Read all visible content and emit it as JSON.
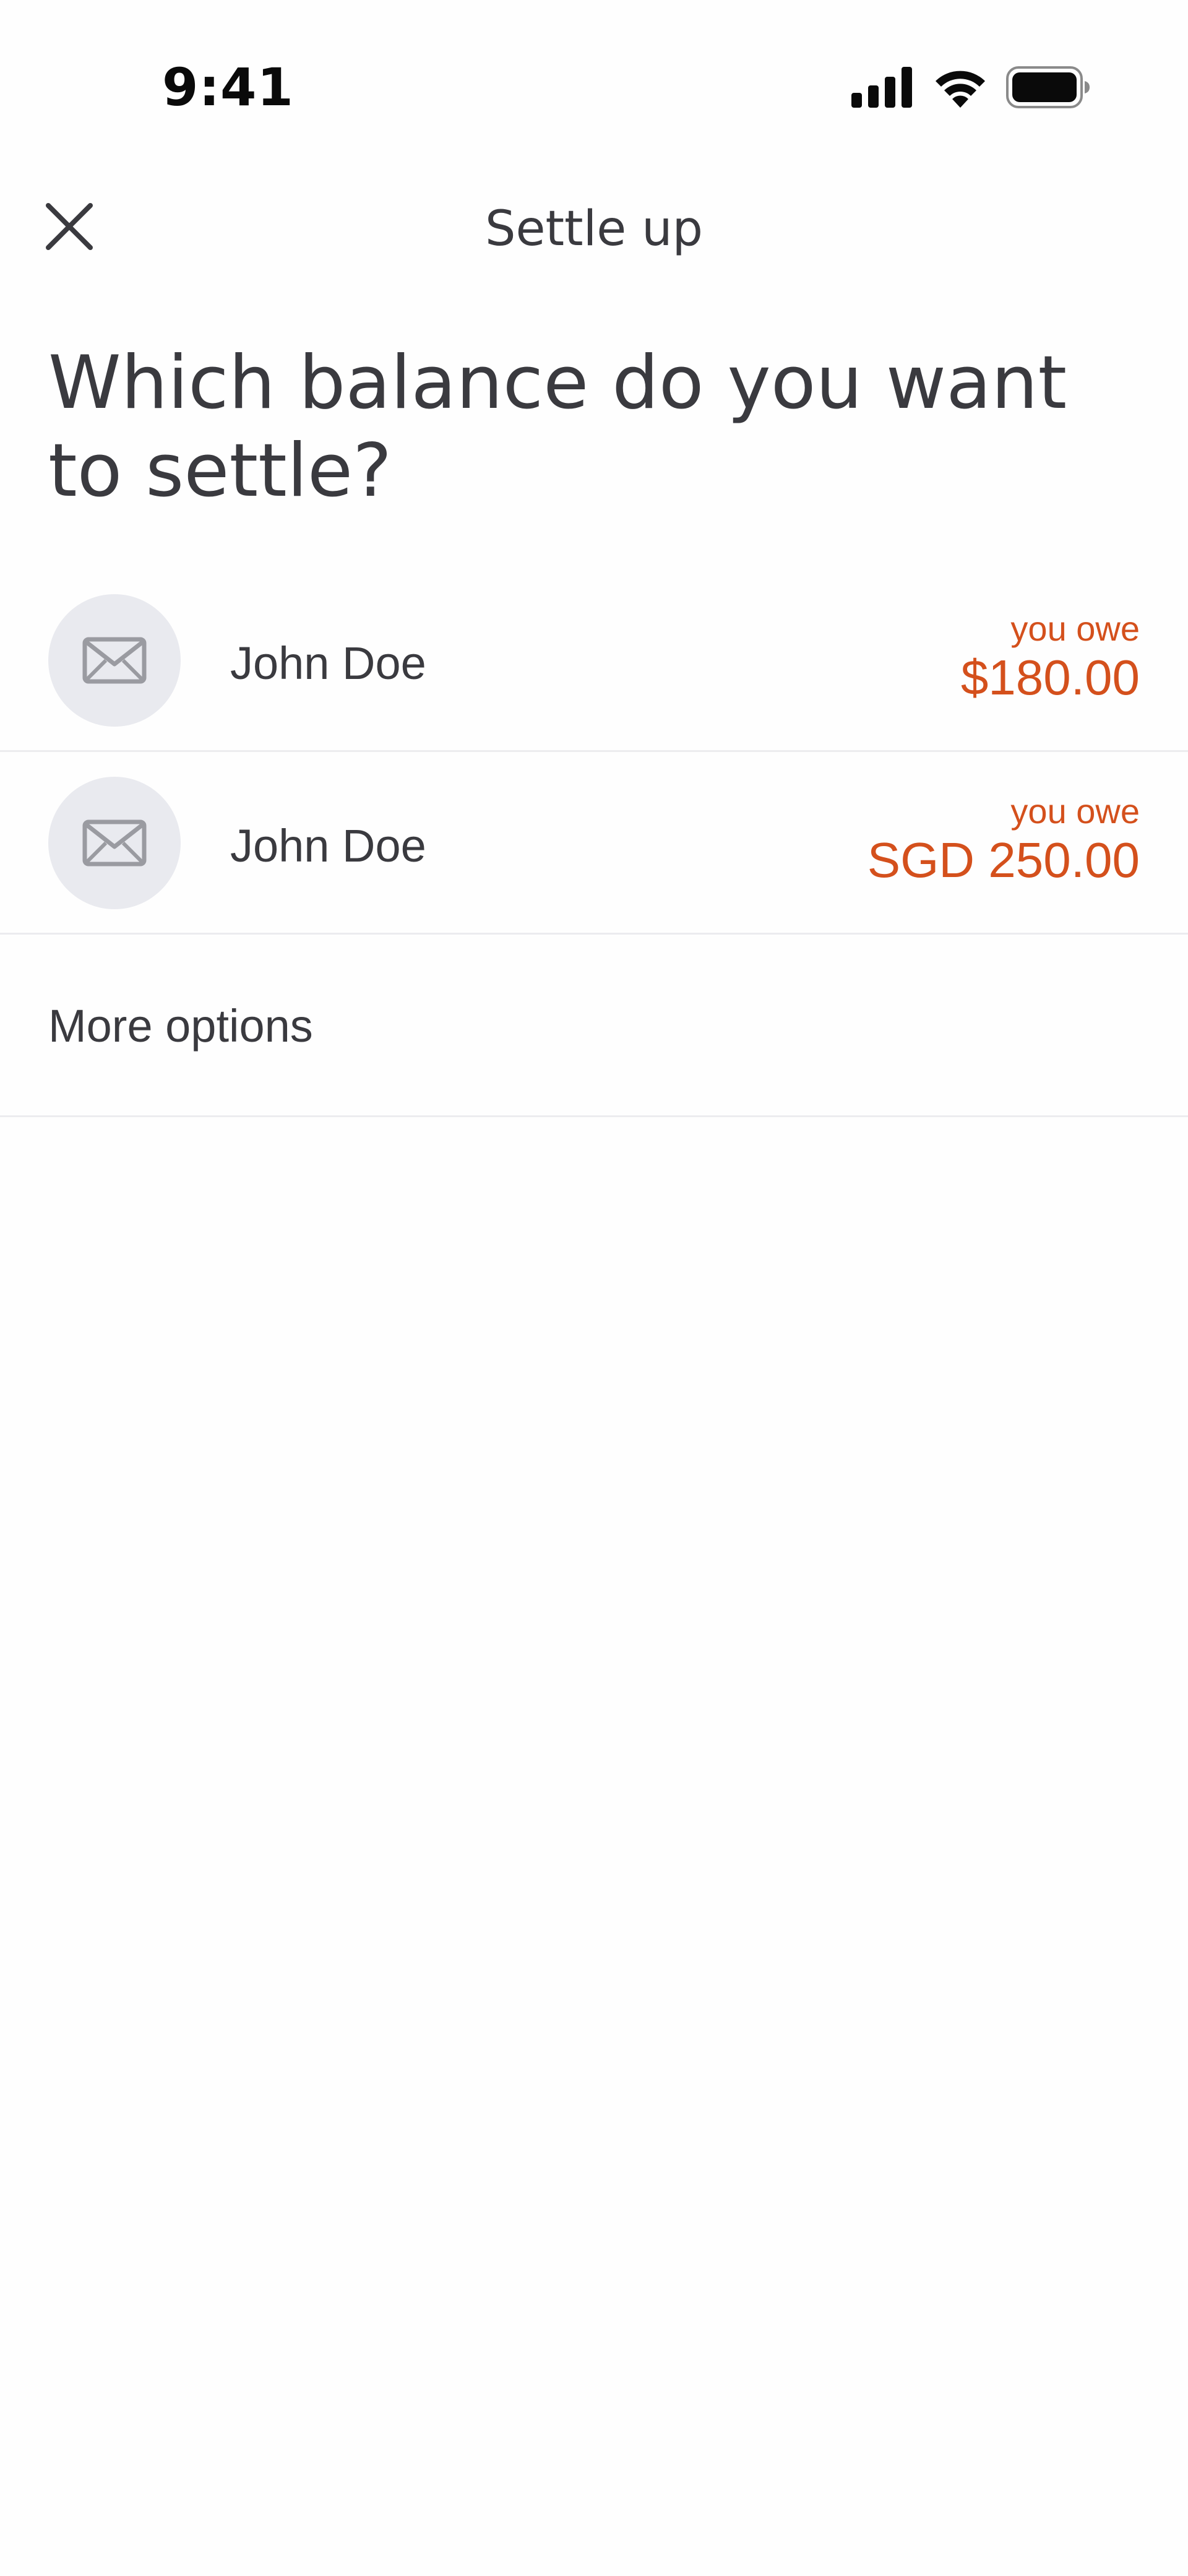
{
  "status_bar": {
    "time": "9:41",
    "icons": [
      "signal-icon",
      "wifi-icon",
      "battery-icon"
    ]
  },
  "header": {
    "title": "Settle up",
    "close_icon": "close-icon"
  },
  "question": "Which balance do you want to settle?",
  "balances": [
    {
      "name": "John Doe",
      "label": "you owe",
      "amount": "$180.00",
      "avatar_icon": "envelope-icon"
    },
    {
      "name": "John Doe",
      "label": "you owe",
      "amount": "SGD 250.00",
      "avatar_icon": "envelope-icon"
    }
  ],
  "more_options": "More options",
  "colors": {
    "text": "#3a3a3f",
    "owe": "#d4501c",
    "avatar_bg": "#e9eaef",
    "divider": "#ececef"
  }
}
